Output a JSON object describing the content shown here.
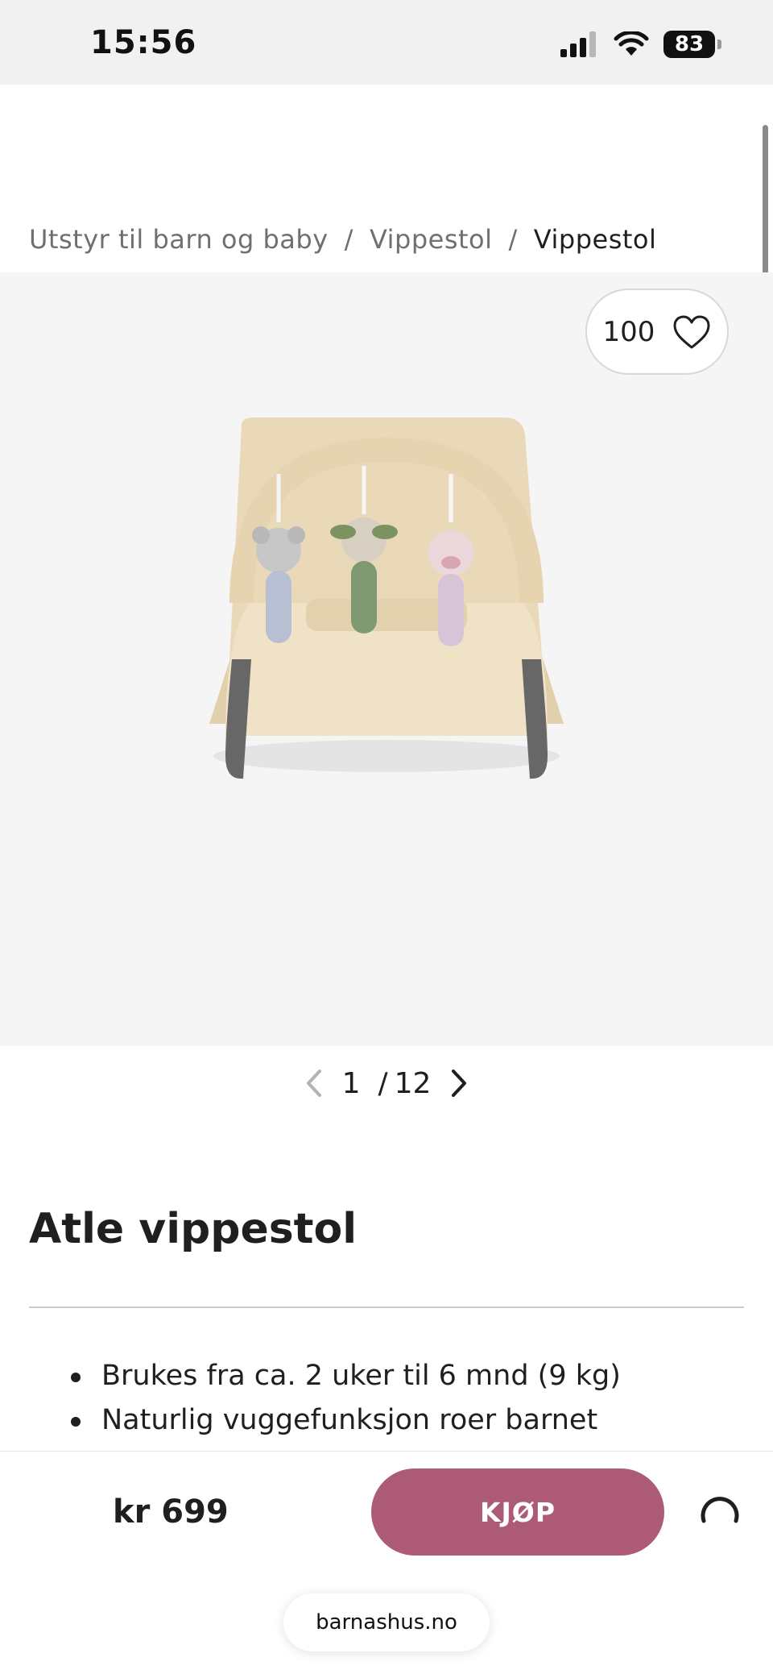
{
  "status_bar": {
    "time": "15:56",
    "battery": "83",
    "icons": [
      "signal-icon",
      "wifi-icon",
      "battery-icon"
    ]
  },
  "breadcrumb": {
    "items": [
      "Utstyr til barn og baby",
      "Vippestol",
      "Vippestol"
    ],
    "separator": "/"
  },
  "gallery": {
    "like_count": "100",
    "current": "1",
    "separator": "/",
    "total": "12",
    "icons": [
      "heart-icon",
      "chevron-left-icon",
      "chevron-right-icon"
    ]
  },
  "product": {
    "title": "Atle vippestol",
    "features": [
      "Brukes fra ca. 2 uker til 6 mnd (9 kg)",
      "Naturlig vuggefunksjon roer barnet"
    ]
  },
  "buy_bar": {
    "price": "kr 699",
    "buy_label": "KJØP",
    "url": "barnashus.no"
  },
  "colors": {
    "accent": "#ad5a77",
    "gallery_bg": "#f5f5f5",
    "status_bg": "#f1f1f1",
    "text": "#1f1f1f",
    "muted_text": "#6f6f6f"
  }
}
